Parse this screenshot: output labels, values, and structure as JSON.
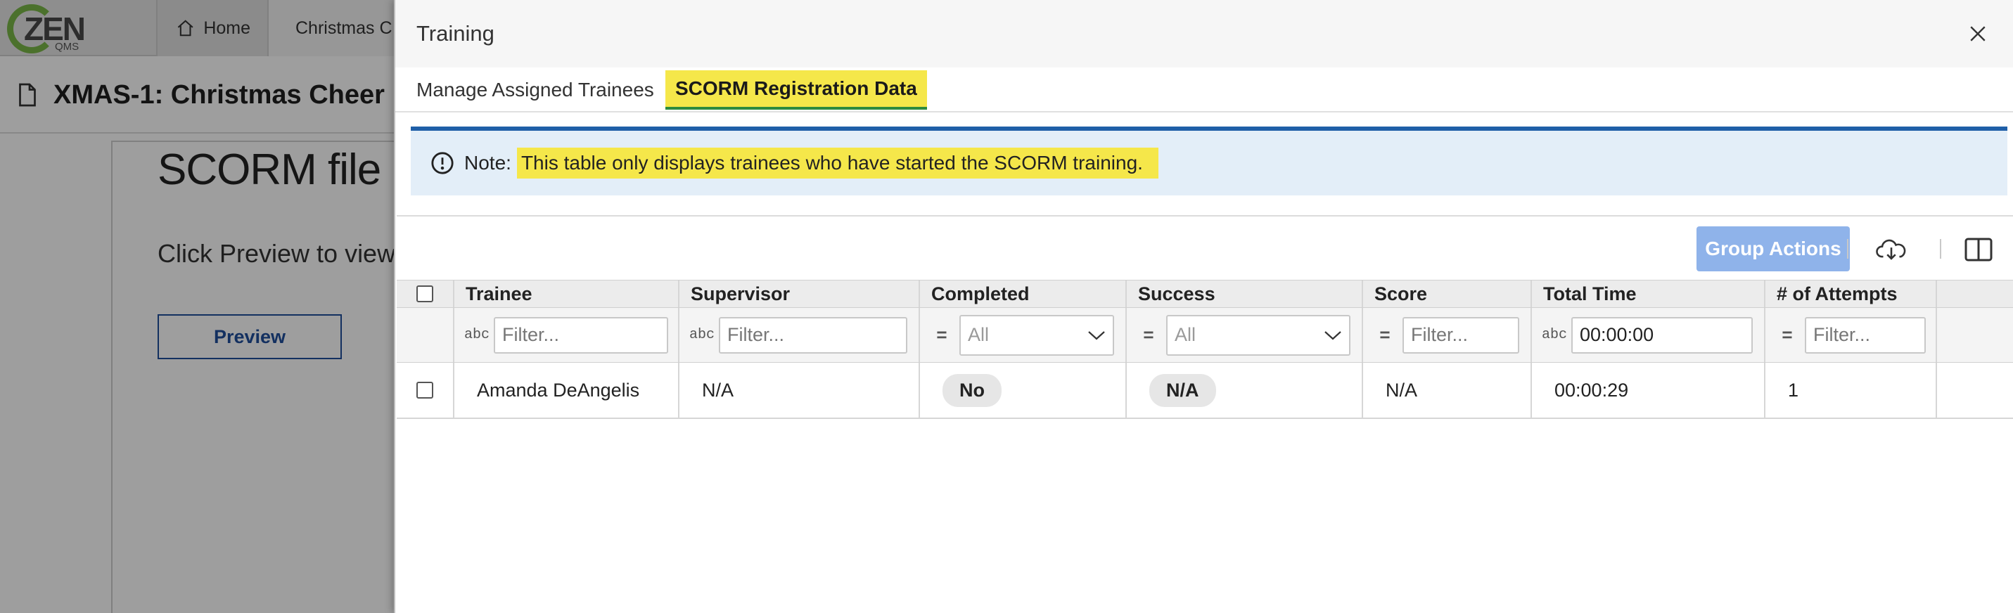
{
  "background": {
    "logo_text": "ZEN",
    "logo_subtext": "QMS",
    "tabs": [
      {
        "label": "Home"
      },
      {
        "label": "Christmas C"
      }
    ],
    "doc_title": "XMAS-1: Christmas Cheer",
    "content_heading": "SCORM file up",
    "content_text": "Click Preview to view",
    "preview_button": "Preview"
  },
  "modal": {
    "title": "Training",
    "tabs": [
      {
        "label": "Manage Assigned Trainees",
        "active": false
      },
      {
        "label": "SCORM Registration Data",
        "active": true
      }
    ],
    "note": {
      "prefix": "Note:",
      "text": "This table only displays trainees who have started the SCORM training."
    },
    "toolbar": {
      "group_actions": "Group Actions",
      "download_icon": "cloud-download-icon",
      "columns_icon": "columns-icon"
    },
    "table": {
      "columns": [
        "Trainee",
        "Supervisor",
        "Completed",
        "Success",
        "Score",
        "Total Time",
        "# of Attempts"
      ],
      "filters": {
        "trainee": {
          "placeholder": "Filter...",
          "value": ""
        },
        "supervisor": {
          "placeholder": "Filter...",
          "value": ""
        },
        "completed": {
          "value": "All"
        },
        "success": {
          "value": "All"
        },
        "score": {
          "placeholder": "Filter...",
          "value": ""
        },
        "total_time": {
          "placeholder": "Filter...",
          "value": "00:00:00"
        },
        "attempts": {
          "placeholder": "Filter...",
          "value": ""
        }
      },
      "rows": [
        {
          "trainee": "Amanda DeAngelis",
          "supervisor": "N/A",
          "completed": "No",
          "success": "N/A",
          "score": "N/A",
          "total_time": "00:00:29",
          "attempts": "1"
        }
      ]
    }
  },
  "colors": {
    "highlight": "#f5e74a",
    "active_tab_underline": "#2e8b3e",
    "note_bg": "#e3eef8",
    "note_border": "#1f5fa8",
    "group_actions_bg": "#8fb3ea"
  }
}
